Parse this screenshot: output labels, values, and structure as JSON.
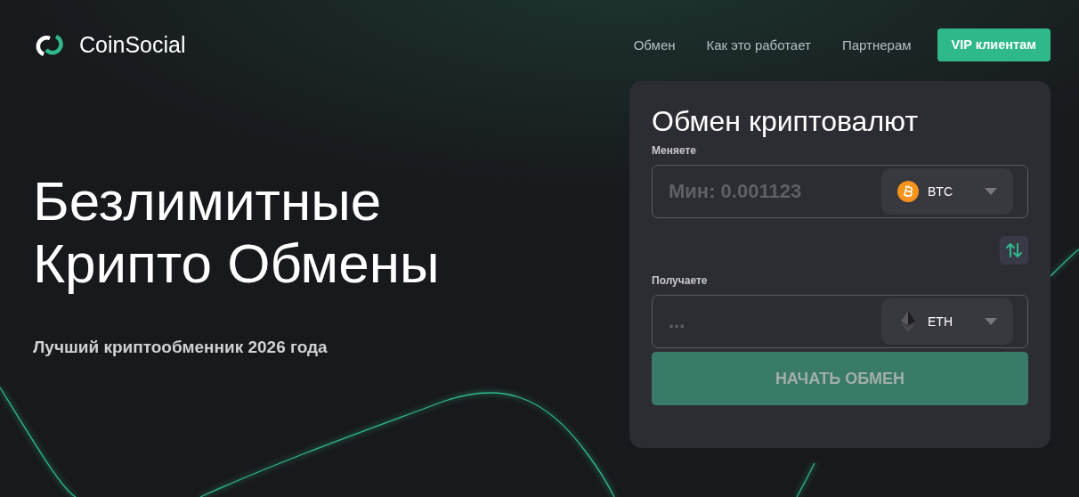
{
  "header": {
    "logo": "CoinSocial",
    "nav": [
      {
        "label": "Обмен",
        "kind": "link"
      },
      {
        "label": "Как это работает",
        "kind": "link"
      },
      {
        "label": "Партнерам",
        "kind": "link"
      },
      {
        "label": "VIP клиентам",
        "kind": "button"
      }
    ]
  },
  "hero": {
    "title_lines": [
      "Безлимитные",
      "Крипто Обмены"
    ],
    "subtitle": "Лучший криптообменник 2026 года"
  },
  "exchange": {
    "title": "Обмен криптовалют",
    "fields": [
      {
        "label": "Меняете",
        "placeholder": "Мин: 0.001123",
        "currency": "BTC",
        "kind": "btc"
      },
      {
        "label": "Получаете",
        "placeholder": "...",
        "currency": "ETH",
        "kind": "eth"
      }
    ],
    "submit": {
      "label": "НАЧАТЬ ОБМЕН",
      "disabled": true
    }
  }
}
